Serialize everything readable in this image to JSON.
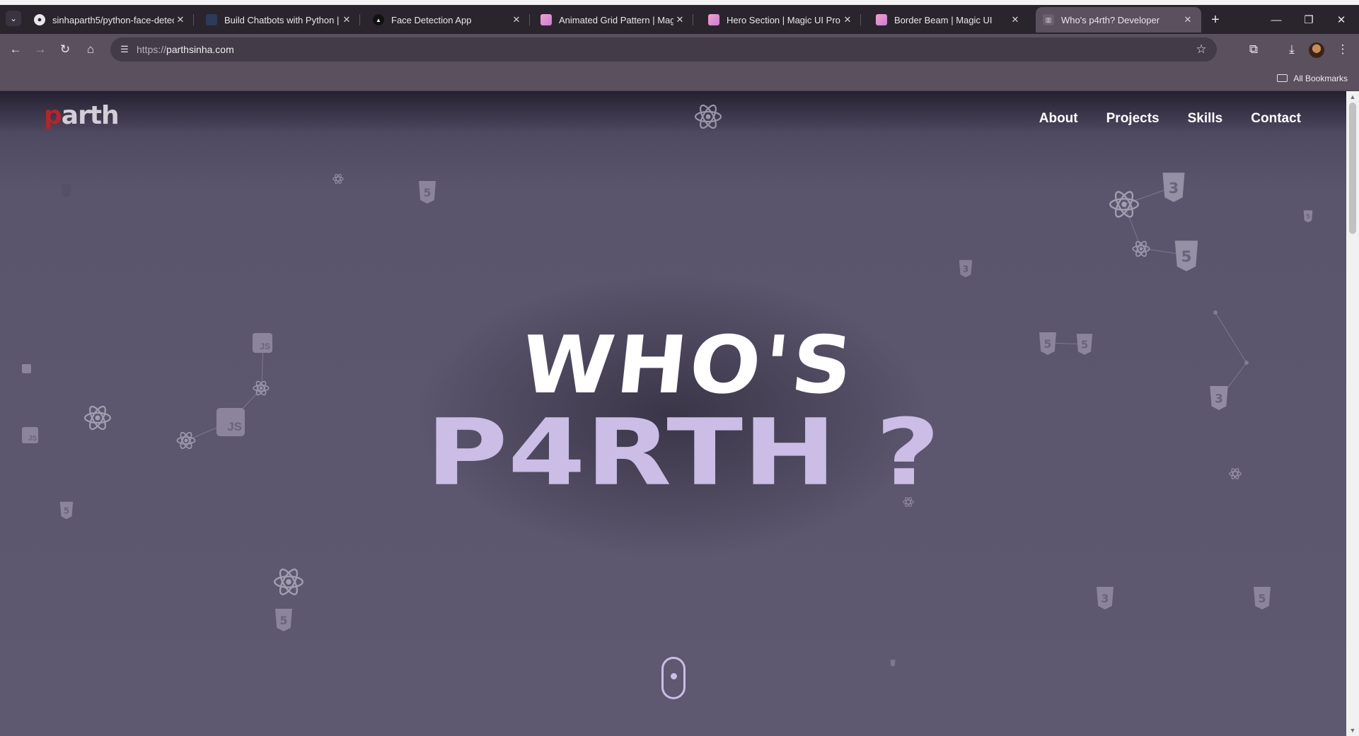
{
  "browser": {
    "tabs": [
      {
        "title": "sinhaparth5/python-face-detec",
        "favicon": "github-icon"
      },
      {
        "title": "Build Chatbots with Python | Co",
        "favicon": "course-icon"
      },
      {
        "title": "Face Detection App",
        "favicon": "triangle-icon"
      },
      {
        "title": "Animated Grid Pattern | Magic U",
        "favicon": "magicui-icon"
      },
      {
        "title": "Hero Section | Magic UI Pro",
        "favicon": "magicui-icon"
      },
      {
        "title": "Border Beam | Magic UI",
        "favicon": "magicui-icon"
      },
      {
        "title": "Who's p4rth? Developer",
        "favicon": "site-icon",
        "active": true
      }
    ],
    "url_scheme": "https://",
    "url_host": "parthsinha.com",
    "bookmarks_label": "All Bookmarks"
  },
  "page": {
    "logo": {
      "accent": "p",
      "rest": "arth"
    },
    "nav": [
      "About",
      "Projects",
      "Skills",
      "Contact"
    ],
    "hero": {
      "line1": "WHO'S",
      "line2": "P4RTH ?"
    },
    "scroll_indicator": "mouse-scroll-icon"
  },
  "colors": {
    "background": "#5a546c",
    "hero_accent": "#cbbde6",
    "logo_accent": "#b0262c",
    "toolbar": "#5a505e"
  }
}
